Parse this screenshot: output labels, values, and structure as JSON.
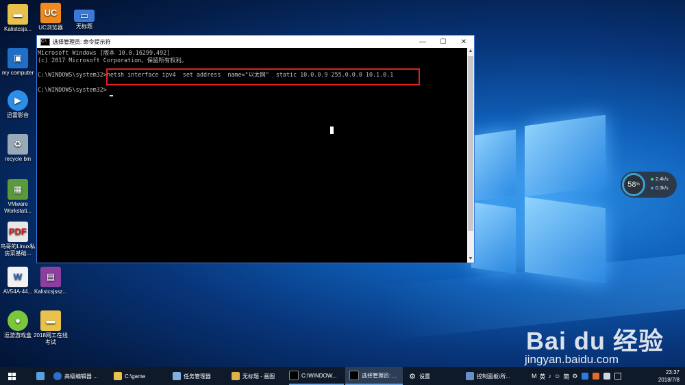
{
  "desktop_icons": [
    {
      "label": "Kalistcsjs...",
      "icon": "folder-icon"
    },
    {
      "label": "UC浏览器",
      "icon": "uc-browser-icon"
    },
    {
      "label": "无标题",
      "icon": "network-computer-icon"
    },
    {
      "label": "my computer",
      "icon": "computer-icon"
    },
    {
      "label": "迅雷影音",
      "icon": "xunlei-player-icon"
    },
    {
      "label": "recycle bin",
      "icon": "recycle-bin-icon"
    },
    {
      "label": "VMware Workstati...",
      "icon": "vmware-icon"
    },
    {
      "label": "鸟哥的Linux私房菜基础...",
      "icon": "pdf-icon"
    },
    {
      "label": "AV54A-44...",
      "icon": "word-doc-icon"
    },
    {
      "label": "Kalistcsjssz...",
      "icon": "winrar-icon"
    },
    {
      "label": "逗游游戏盒",
      "icon": "game-box-icon"
    },
    {
      "label": "2018网工在线考试",
      "icon": "folder-icon"
    }
  ],
  "cmd_window": {
    "title": "选择管理员: 命令提示符",
    "lines": [
      "Microsoft Windows [版本 10.0.16299.492]",
      "(c) 2017 Microsoft Corporation。保留所有权利。",
      "",
      "C:\\WINDOWS\\system32>netsh interface ipv4  set address  name=\"以太网\"  static 10.0.0.9 255.0.0.0 10.1.0.1",
      "",
      "C:\\WINDOWS\\system32>"
    ],
    "minimize": "—",
    "maximize": "☐",
    "close": "✕"
  },
  "speed_widget": {
    "percent": "58",
    "percent_unit": "%",
    "upload": "2.4k/s",
    "download": "0.3k/s"
  },
  "watermark": {
    "brand": "Bai du 经验",
    "url": "jingyan.baidu.com"
  },
  "taskbar": {
    "items": [
      {
        "label": "",
        "icon": "explorer-icon"
      },
      {
        "label": "高级编辑器 ...",
        "icon": "editor-icon"
      },
      {
        "label": "C:\\game",
        "icon": "folder-icon"
      },
      {
        "label": "任务管理器",
        "icon": "task-manager-icon"
      },
      {
        "label": "无标题 - 画图",
        "icon": "paint-icon"
      },
      {
        "label": "C:\\WINDOW...",
        "icon": "cmd-icon"
      },
      {
        "label": "选择管理员: ...",
        "icon": "cmd-icon"
      },
      {
        "label": "设置",
        "icon": "gear-icon"
      },
      {
        "label": "控制面板\\所...",
        "icon": "control-panel-icon"
      }
    ],
    "tray": [
      "M",
      "英",
      "♪",
      "☺",
      "简",
      "⚙",
      "",
      "",
      "",
      ""
    ],
    "time": "23:37",
    "date": "2018/7/8"
  }
}
